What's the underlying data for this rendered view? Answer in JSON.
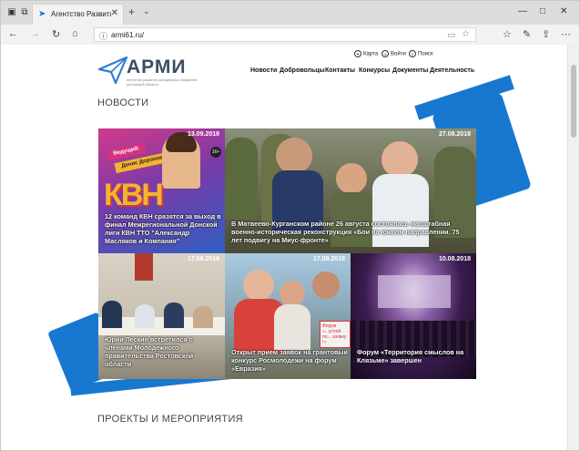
{
  "browser": {
    "tab_title": "Агентство Развития Мс",
    "url": "armi61.ru/"
  },
  "site": {
    "logo_name": "АРМИ",
    "logo_sub": "агентство развития молодёжных инициатив ростовской области",
    "util": [
      {
        "icon": "map-pin-icon",
        "label": "Карта"
      },
      {
        "icon": "user-icon",
        "label": "Войти"
      },
      {
        "icon": "search-icon",
        "label": "Поиск"
      }
    ],
    "menu": [
      "Новости",
      "Добровольцы",
      "Контакты",
      "Конкурсы",
      "Документы",
      "Деятельность"
    ]
  },
  "news": {
    "title": "НОВОСТИ",
    "tile1_badge": "Ведущий:",
    "tile1_host": "Денис Дорохов",
    "tile1_logo": "КВН",
    "tile4_banner": "Форум «...успей по... заявку !»",
    "tiles": [
      {
        "date": "13.09.2018",
        "caption": "12 команд КВН сразятся за выход в финал Межрегиональной Донской лиги КВН ТТО \"Александр Масляков и Компания\""
      },
      {
        "date": "27.08.2018",
        "caption": "В Матвеево-Курганском районе 26 августа состоялась масштабная военно-историческая реконструкция «Бои на южном направлении. 75 лет подвигу на Миус-фронте»"
      },
      {
        "date": "17.08.2018",
        "caption": "Юрий Лескин встретился с членами Молодежного правительства Ростовской области"
      },
      {
        "date": "17.08.2018",
        "caption": "Открыт прием заявок на грантовый конкурс Росмолодежи на форум «Евразия»"
      },
      {
        "date": "10.08.2018",
        "caption": "Форум «Территория смыслов на Клязьме» завершен"
      }
    ]
  },
  "projects": {
    "title": "ПРОЕКТЫ И МЕРОПРИЯТИЯ"
  },
  "colors": {
    "brand_blue": "#1878d0",
    "logo_text": "#3b4e63"
  }
}
